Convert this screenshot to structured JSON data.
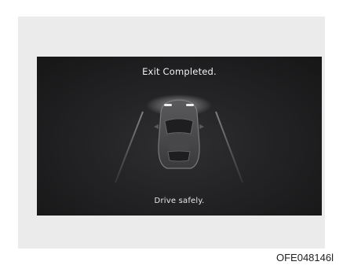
{
  "screen": {
    "title": "Exit Completed.",
    "message": "Drive safely."
  },
  "figure_code": "OFE048146l"
}
